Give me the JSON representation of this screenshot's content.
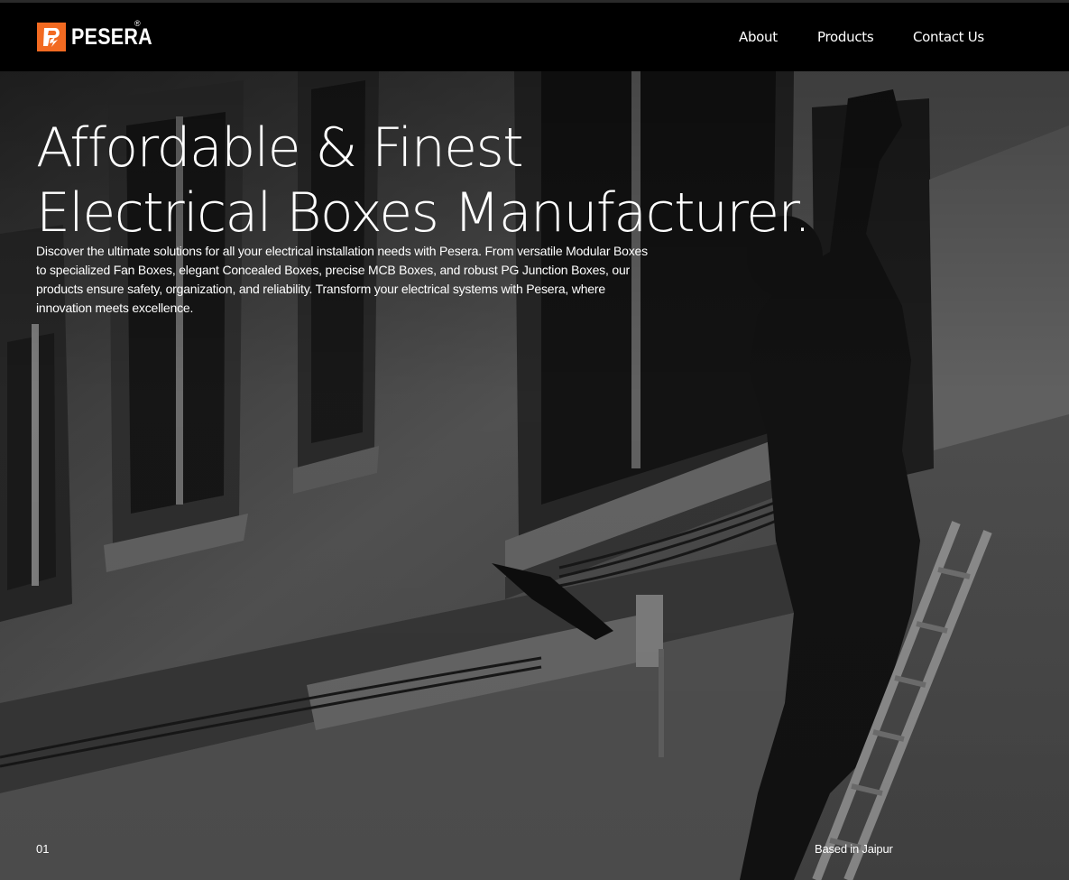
{
  "brand": {
    "name": "PESERA",
    "registered_mark": "®",
    "logo_color": "#F26A21"
  },
  "nav": {
    "items": [
      {
        "label": "About"
      },
      {
        "label": "Products"
      },
      {
        "label": "Contact Us"
      }
    ]
  },
  "hero": {
    "headline_line1": "Affordable & Finest",
    "headline_line2": "Electrical Boxes Manufacturer.",
    "description": "Discover the ultimate solutions for all your electrical installation needs with Pesera. From versatile Modular Boxes to specialized Fan Boxes, elegant Concealed Boxes, precise MCB Boxes, and robust PG Junction Boxes, our products ensure safety, organization, and reliability. Transform your electrical systems with Pesera, where innovation meets excellence.",
    "slide_number": "01",
    "location": "Based in Jaipur",
    "background_icon": "electrician-on-ladder-photo"
  }
}
